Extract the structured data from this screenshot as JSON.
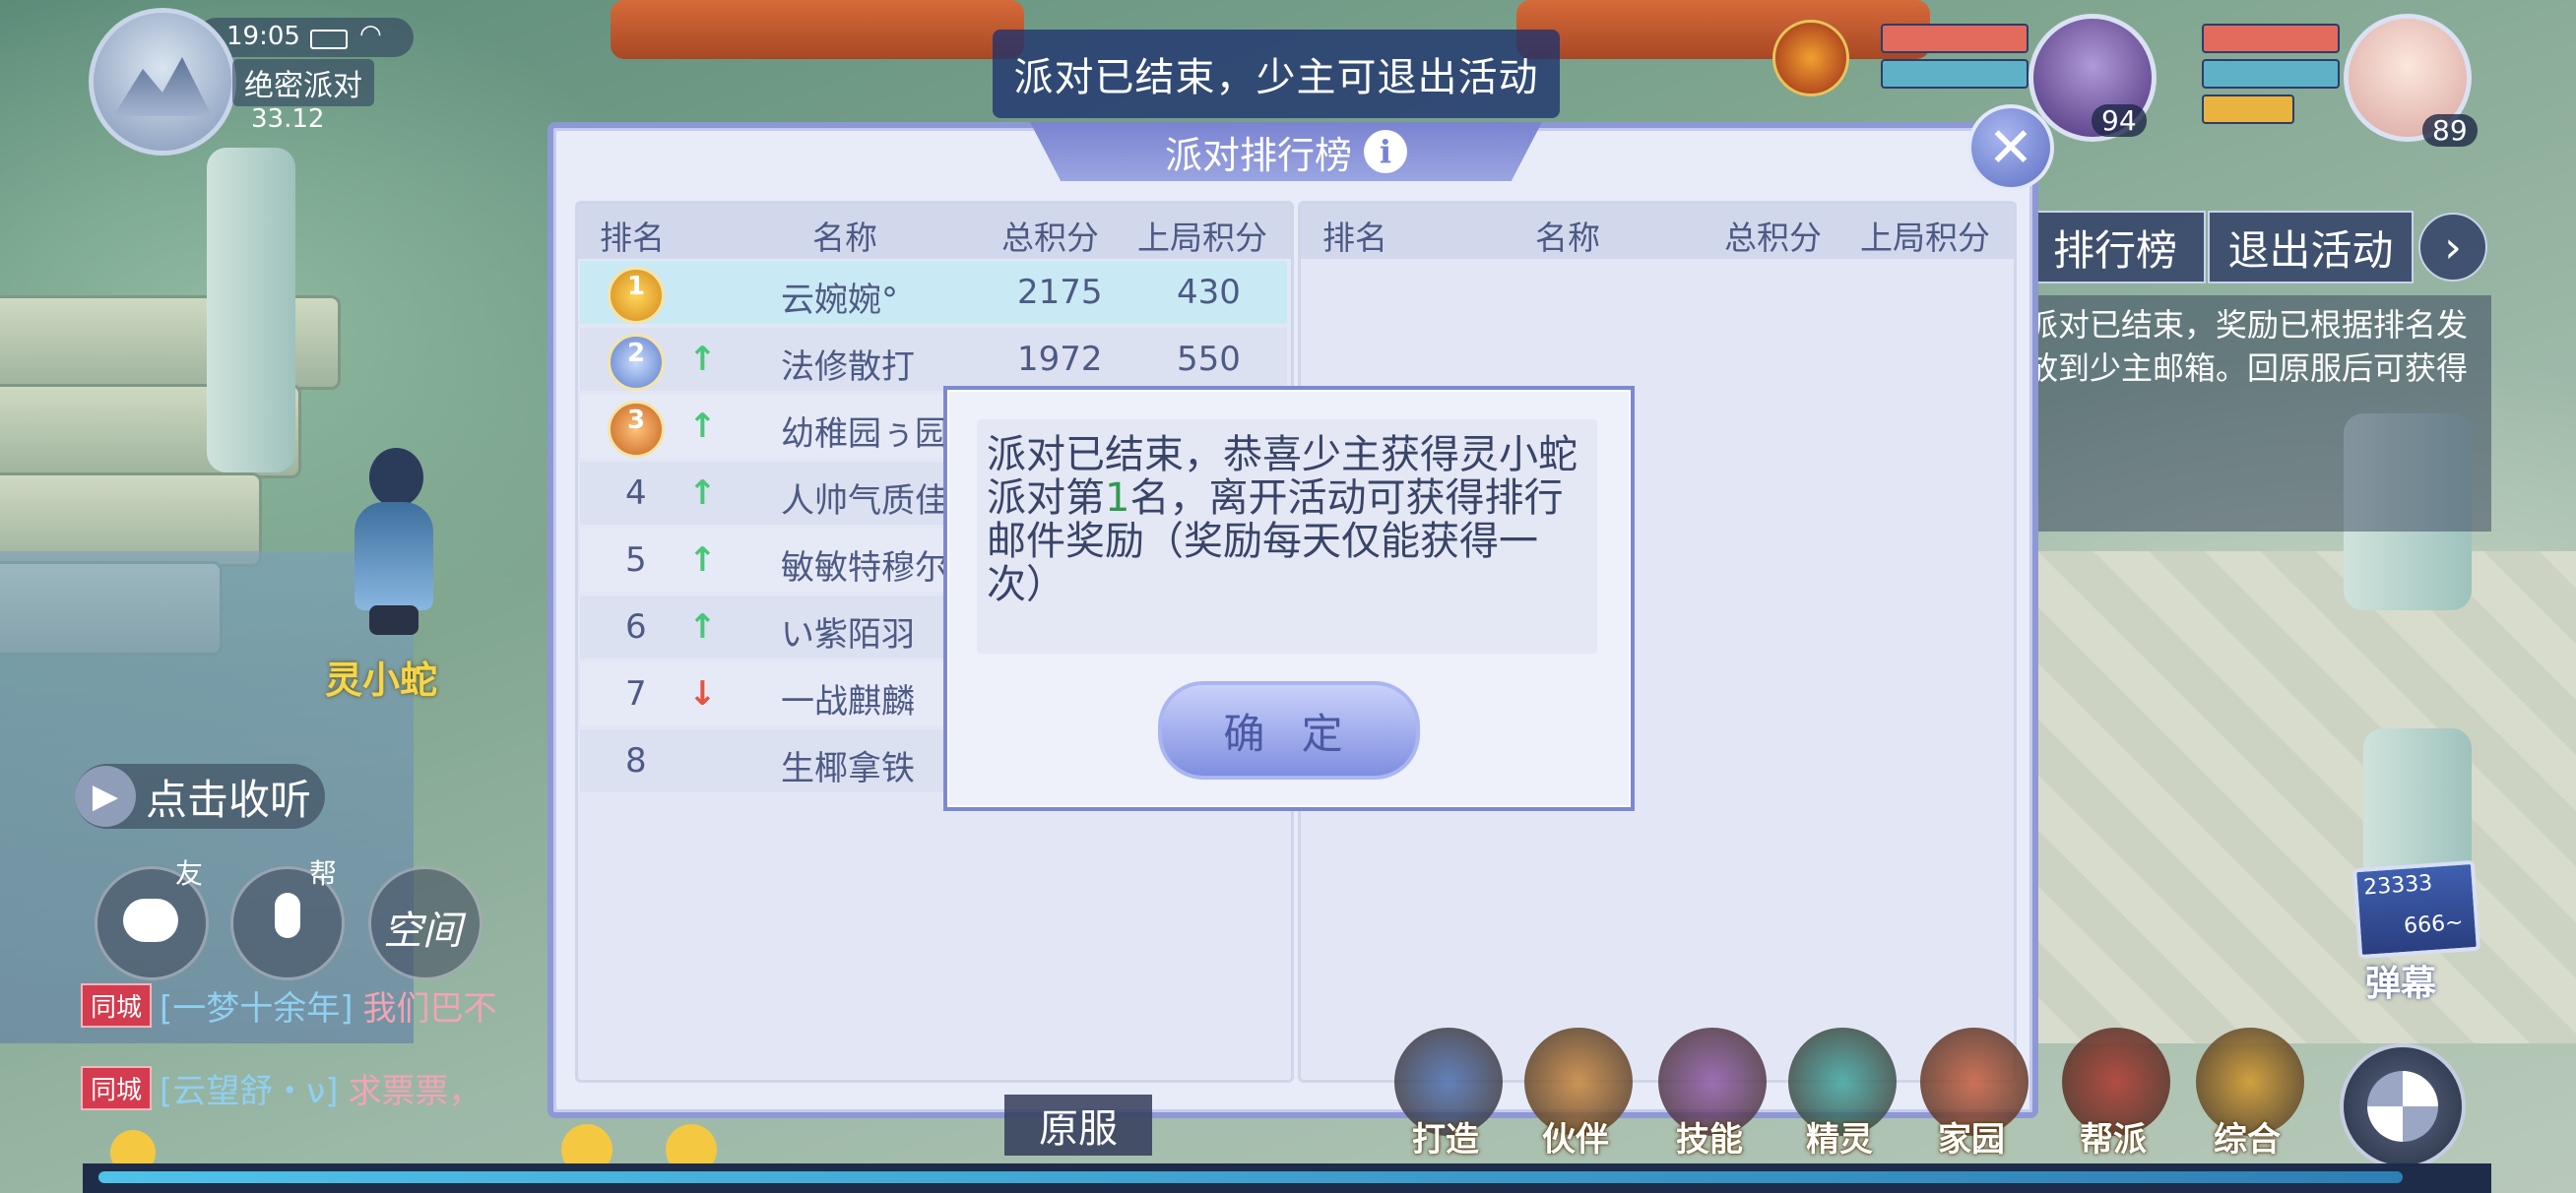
{
  "hud": {
    "time": "19:05",
    "activity_name": "绝密派对",
    "score": "33.12"
  },
  "banner": {
    "text": "派对已结束，少主可退出活动"
  },
  "party_members": [
    {
      "level": "94"
    },
    {
      "level": "89"
    }
  ],
  "panel": {
    "title": "派对排行榜",
    "info_icon": "i",
    "close_icon": "close-icon",
    "columns": [
      "排名",
      "名称",
      "总积分",
      "上局积分"
    ],
    "left_rows": [
      {
        "rank": "1",
        "medal": "gold",
        "trend": "",
        "name": "云婉婉°",
        "total": "2175",
        "last": "430"
      },
      {
        "rank": "2",
        "medal": "silver",
        "trend": "up",
        "name": "法修散打",
        "total": "1972",
        "last": "550"
      },
      {
        "rank": "3",
        "medal": "bronze",
        "trend": "up",
        "name": "幼稚园ぅ园长",
        "total": "",
        "last": ""
      },
      {
        "rank": "4",
        "medal": "",
        "trend": "up",
        "name": "人帅气质佳",
        "total": "",
        "last": ""
      },
      {
        "rank": "5",
        "medal": "",
        "trend": "up",
        "name": "敏敏特穆尔",
        "total": "",
        "last": ""
      },
      {
        "rank": "6",
        "medal": "",
        "trend": "up",
        "name": "い紫陌羽",
        "total": "",
        "last": ""
      },
      {
        "rank": "7",
        "medal": "",
        "trend": "down",
        "name": "一战麒麟",
        "total": "",
        "last": ""
      },
      {
        "rank": "8",
        "medal": "",
        "trend": "",
        "name": "生椰拿铁",
        "total": "",
        "last": ""
      }
    ]
  },
  "modal": {
    "text_before": "派对已结束，恭喜少主获得灵小蛇派对第",
    "rank_number": "1",
    "text_after": "名，离开活动可获得排行邮件奖励（奖励每天仅能获得一次）",
    "confirm_label": "确 定"
  },
  "side": {
    "ranking_button": "排行榜",
    "exit_button": "退出活动",
    "info_text": "派对已结束，奖励已根据排名发放到少主邮箱。回原服后可获得"
  },
  "world": {
    "player_name": "灵小蛇",
    "listen_label": "点击收听",
    "friend_label": "友",
    "guild_label": "帮",
    "space_label": "空间",
    "barrage_count": "23333",
    "barrage_sub": "666~",
    "barrage_label": "弹幕",
    "return_label": "原服"
  },
  "chat": [
    {
      "channel": "同城",
      "sender": "[一梦十余年]",
      "message": "我们巴不"
    },
    {
      "channel": "同城",
      "sender": "[云望舒・ν]",
      "message": "求票票，"
    }
  ],
  "dock": [
    "打造",
    "伙伴",
    "技能",
    "精灵",
    "家园",
    "帮派",
    "综合"
  ],
  "colors": {
    "panel_border": "#8d98d4",
    "title_bar": "#7a83d0",
    "highlight_row": "#c9eaf4",
    "trend_up": "#4ac67a",
    "trend_down": "#e4533f",
    "rank_highlight": "#2f9a4c"
  }
}
